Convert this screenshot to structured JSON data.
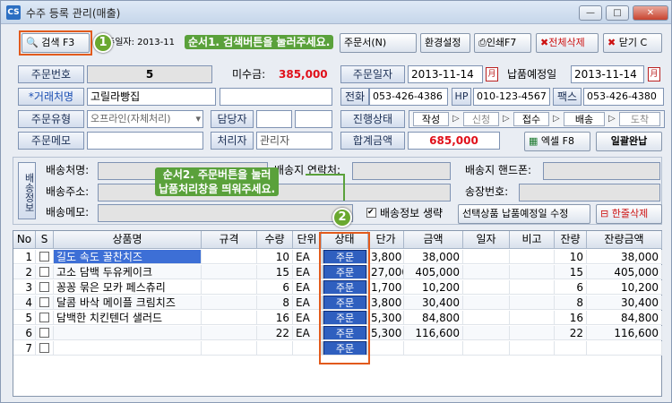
{
  "window": {
    "icon": "CS",
    "title": "수주 등록 관리(매출)",
    "min": "—",
    "max": "□",
    "close": "✕"
  },
  "toolbar": {
    "search": "검색 F3",
    "date_text": "주일자: 2013-11",
    "order_doc": "주문서(N)",
    "settings": "환경설정",
    "print": "인쇄F7",
    "delete_all": "전체삭제",
    "close": "닫기 C"
  },
  "tips": {
    "tip1": "순서1. 검색버튼을 눌러주세요.",
    "tip2": "순서2. 주문버튼을 눌러\n납품처리창을 띄워주세요.",
    "num1": "1",
    "num2": "2"
  },
  "form": {
    "order_no_label": "주문번호",
    "order_no": "5",
    "unpaid_label": "미수금:",
    "unpaid": "385,000",
    "order_date_label": "주문일자",
    "order_date": "2013-11-14",
    "delivery_date_label": "납품예정일",
    "delivery_date": "2013-11-14",
    "client_label": "*거래처명",
    "client": "고릴라빵집",
    "phone_label": "전화",
    "phone": "053-426-4386",
    "hp_label": "HP",
    "hp": "010-123-4567",
    "fax_label": "팩스",
    "fax": "053-426-4380",
    "type_label": "주문유형",
    "type": "오프라인(자체처리)",
    "manager_label": "담당자",
    "progress_label": "진행상태",
    "progress_steps": [
      "작성",
      "신청",
      "접수",
      "배송",
      "도착"
    ],
    "memo_label": "주문메모",
    "handler_label": "처리자",
    "handler": "관리자",
    "total_label": "합계금액",
    "total": "685,000",
    "excel": "엑셀 F8",
    "complete": "일괄완납"
  },
  "shipping": {
    "section": "배송정보",
    "name": "배송처명:",
    "contact": "배송지 연락처:",
    "mobile": "배송지 핸드폰:",
    "address": "배송주소:",
    "invoice": "송장번호:",
    "memo": "배송메모:",
    "omit": "배송정보 생략",
    "set_date": "선택상품 납품예정일 수정",
    "delete_row": "한줄삭제"
  },
  "table": {
    "headers": [
      "No",
      "S",
      "상품명",
      "규격",
      "수량",
      "단위",
      "상태",
      "단가",
      "금액",
      "일자",
      "비고",
      "잔량",
      "잔량금액"
    ],
    "rows": [
      {
        "no": "1",
        "name": "길도 속도 꿀찬치즈",
        "qty": "10",
        "unit": "EA",
        "status": "주문",
        "price": "3,800",
        "amount": "38,000",
        "remain": "10",
        "remain_amount": "38,000"
      },
      {
        "no": "2",
        "name": "고소 담백 두유케이크",
        "qty": "15",
        "unit": "EA",
        "status": "주문",
        "price": "27,000",
        "amount": "405,000",
        "remain": "15",
        "remain_amount": "405,000"
      },
      {
        "no": "3",
        "name": "꽁꽁 묶은 모카 페스츄리",
        "qty": "6",
        "unit": "EA",
        "status": "주문",
        "price": "1,700",
        "amount": "10,200",
        "remain": "6",
        "remain_amount": "10,200"
      },
      {
        "no": "4",
        "name": "달콤 바삭 메이플 크림치즈",
        "qty": "8",
        "unit": "EA",
        "status": "주문",
        "price": "3,800",
        "amount": "30,400",
        "remain": "8",
        "remain_amount": "30,400"
      },
      {
        "no": "5",
        "name": "담백한 치킨텐더 샐러드",
        "qty": "16",
        "unit": "EA",
        "status": "주문",
        "price": "5,300",
        "amount": "84,800",
        "remain": "16",
        "remain_amount": "84,800"
      },
      {
        "no": "6",
        "name": "",
        "qty": "22",
        "unit": "EA",
        "status": "주문",
        "price": "5,300",
        "amount": "116,600",
        "remain": "22",
        "remain_amount": "116,600"
      },
      {
        "no": "7",
        "name": "",
        "qty": "",
        "unit": "",
        "status": "주문",
        "price": "",
        "amount": "",
        "remain": "",
        "remain_amount": ""
      }
    ]
  }
}
